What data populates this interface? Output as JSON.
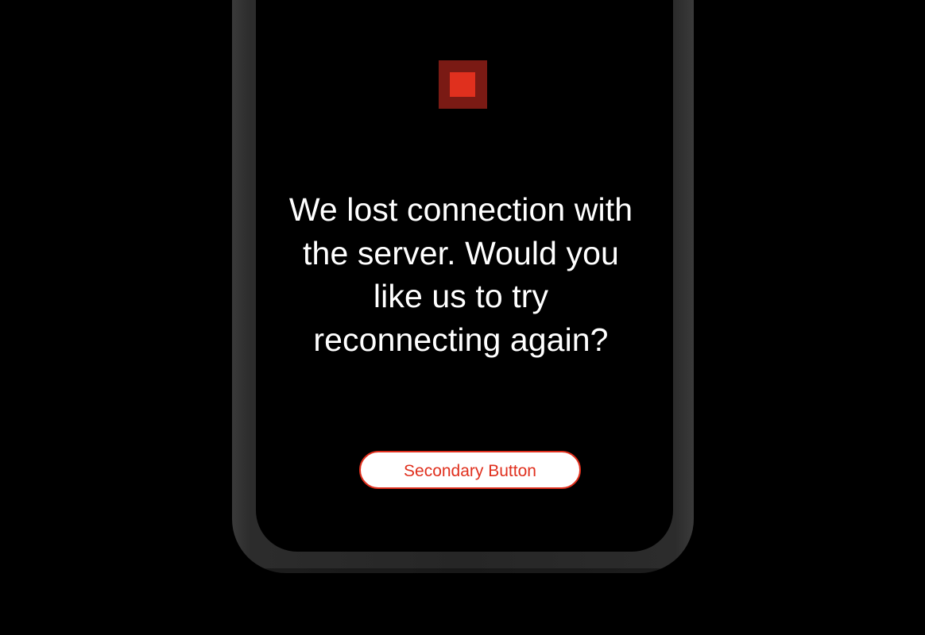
{
  "dialog": {
    "message": "We lost connection with the server. Would you like us to try reconnecting again?",
    "secondary_button_label": "Secondary Button"
  },
  "logo": {
    "icon": "stop-square-icon"
  },
  "colors": {
    "background": "#000000",
    "accent": "#e0301e",
    "accent_dark": "#7a1a14",
    "text": "#ffffff",
    "button_background": "#ffffff"
  }
}
